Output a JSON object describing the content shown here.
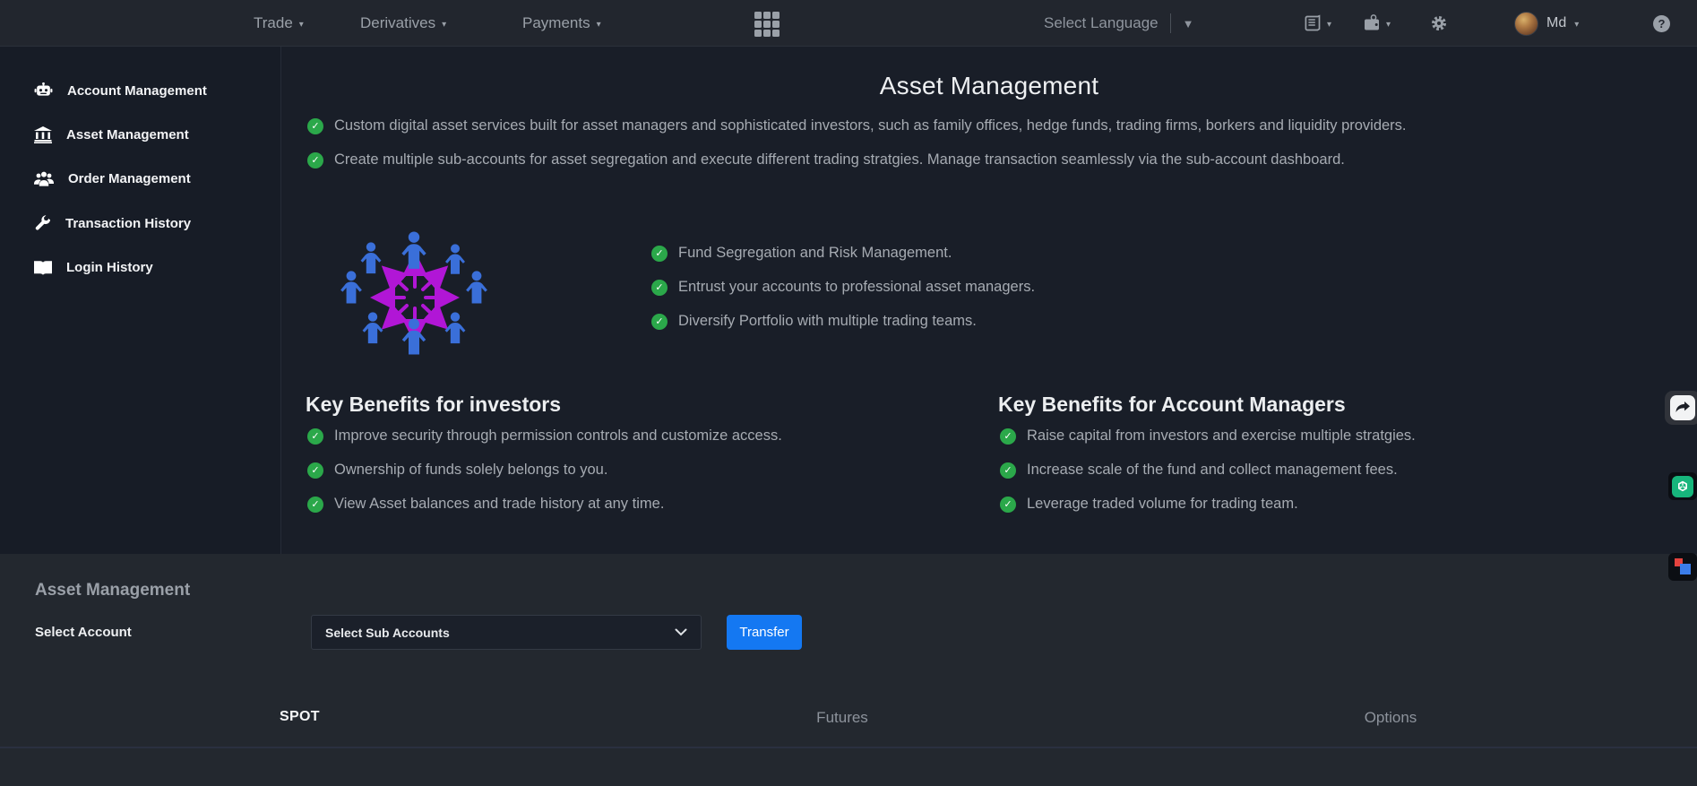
{
  "navbar": {
    "menus": [
      {
        "label": "Trade"
      },
      {
        "label": "Derivatives"
      },
      {
        "label": "Payments"
      }
    ],
    "language_label": "Select Language",
    "username": "Md"
  },
  "sidebar": {
    "items": [
      {
        "label": "Account Management",
        "icon": "robot-icon"
      },
      {
        "label": "Asset Management",
        "icon": "bank-icon"
      },
      {
        "label": "Order Management",
        "icon": "users-icon"
      },
      {
        "label": "Transaction History",
        "icon": "wrench-icon"
      },
      {
        "label": "Login History",
        "icon": "open-book-icon"
      }
    ]
  },
  "main": {
    "title": "Asset Management",
    "intro_bullets": [
      "Custom digital asset services built for asset managers and sophisticated investors, such as family offices, hedge funds, trading firms, borkers and liquidity providers.",
      "Create multiple sub-accounts for asset segregation and execute different trading stratgies. Manage transaction seamlessly via the sub-account dashboard."
    ],
    "feature_bullets": [
      "Fund Segregation and Risk Management.",
      "Entrust your accounts to professional asset managers.",
      "Diversify Portfolio with multiple trading teams."
    ],
    "investors": {
      "title": "Key Benefits for investors",
      "bullets": [
        "Improve security through permission controls and customize access.",
        "Ownership of funds solely belongs to you.",
        "View Asset balances and trade history at any time."
      ]
    },
    "managers": {
      "title": "Key Benefits for Account Managers",
      "bullets": [
        "Raise capital from investors and exercise multiple stratgies.",
        "Increase scale of the fund and collect management fees.",
        "Leverage traded volume for trading team."
      ]
    }
  },
  "panel": {
    "title": "Asset Management",
    "select_account_label": "Select Account",
    "dropdown_value": "Select Sub Accounts",
    "transfer_button": "Transfer",
    "tabs": [
      {
        "label": "SPOT",
        "active": true
      },
      {
        "label": "Futures",
        "active": false
      },
      {
        "label": "Options",
        "active": false
      }
    ]
  },
  "glyphs": {
    "check": "✓",
    "caret": "▾",
    "dropdown_arrow": "▼",
    "help": "?"
  },
  "colors": {
    "accent_blue": "#1478f2",
    "check_green": "#2ba84a",
    "person_blue": "#3a6fd9",
    "arrow_magenta": "#b116d6"
  }
}
